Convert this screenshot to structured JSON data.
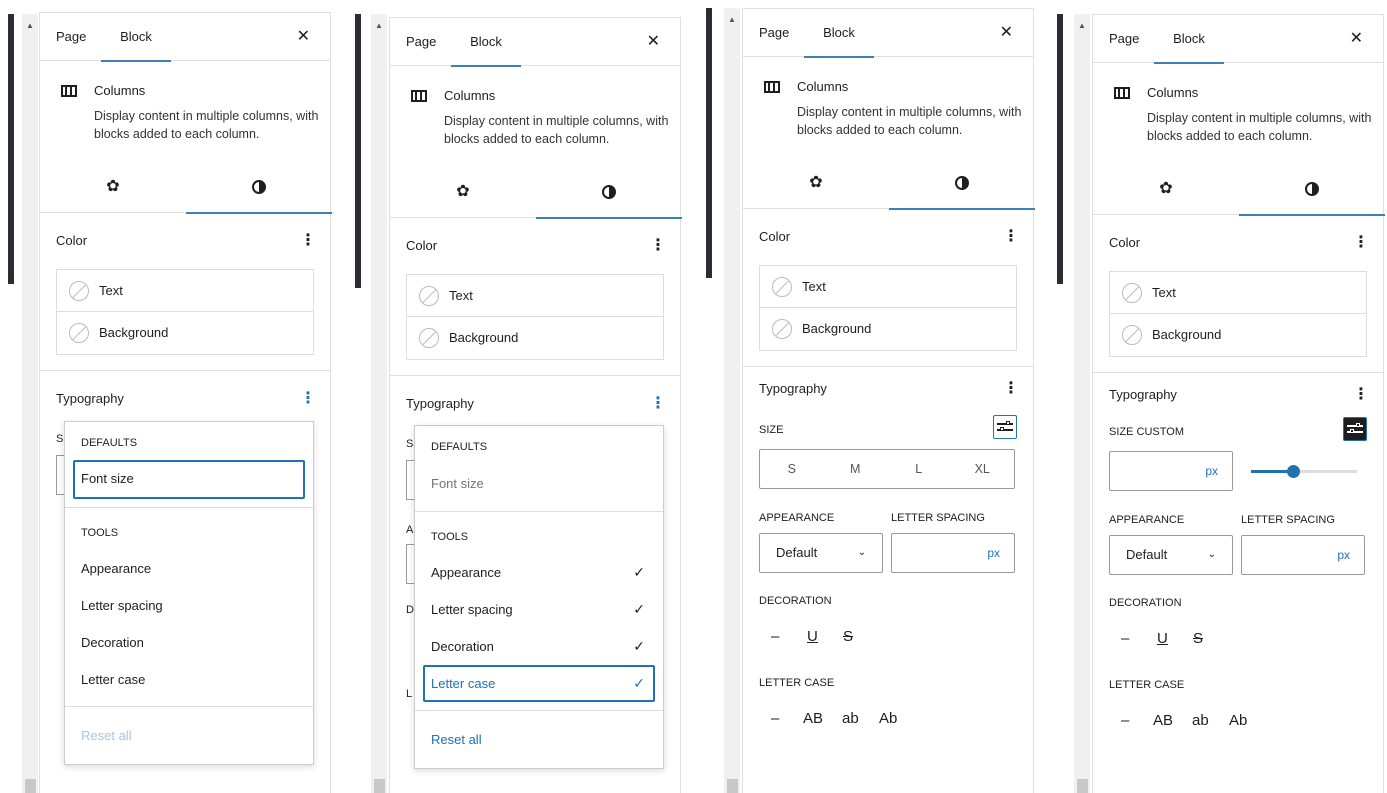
{
  "tabs": {
    "page": "Page",
    "block": "Block"
  },
  "close": "✕",
  "block": {
    "title": "Columns",
    "description": "Display content in multiple columns, with blocks added to each column."
  },
  "color": {
    "title": "Color",
    "text": "Text",
    "background": "Background"
  },
  "typography": {
    "title": "Typography",
    "size": "SIZE",
    "size_custom": "CUSTOM",
    "appearance": "APPEARANCE",
    "letter_spacing": "LETTER SPACING",
    "decoration": "DECORATION",
    "letter_case": "LETTER CASE",
    "appearance_value": "Default",
    "unit": "px",
    "sizes": [
      "S",
      "M",
      "L",
      "XL"
    ],
    "decoration_options": [
      "–",
      "U",
      "S"
    ],
    "case_options": [
      "–",
      "AB",
      "ab",
      "Ab"
    ],
    "custom_size_fraction": 0.4,
    "hidden_letters": {
      "s": "S",
      "a": "A",
      "d": "D",
      "l": "L"
    }
  },
  "menu": {
    "defaults": "DEFAULTS",
    "font_size": "Font size",
    "tools": "TOOLS",
    "appearance": "Appearance",
    "letter_spacing": "Letter spacing",
    "decoration": "Decoration",
    "letter_case": "Letter case",
    "reset_all": "Reset all",
    "check": "✓"
  },
  "glyphs": {
    "kebab": "⋮",
    "gear": "✿",
    "scroll_up": "▲",
    "chevron": "⌄"
  }
}
